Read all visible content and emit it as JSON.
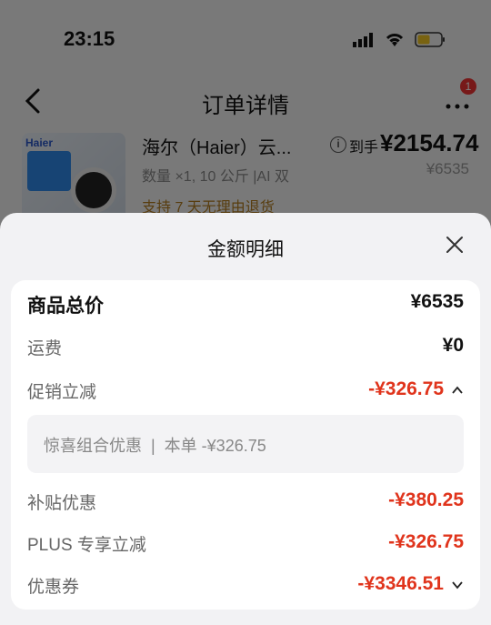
{
  "status_bar": {
    "time": "23:15"
  },
  "nav": {
    "title": "订单详情",
    "badge_count": "1"
  },
  "product": {
    "thumb_brand": "Haier",
    "name": "海尔（Haier）云...",
    "spec": "数量 ×1, 10 公斤 |AI 双",
    "return_policy": "支持 7 天无理由退货",
    "price_label": "到手",
    "price_main": "¥2154.74",
    "price_original": "¥6535"
  },
  "sheet": {
    "title": "金额明细",
    "rows": {
      "total": {
        "label": "商品总价",
        "value": "¥6535"
      },
      "shipping": {
        "label": "运费",
        "value": "¥0"
      },
      "promo": {
        "label": "促销立减",
        "value": "-¥326.75"
      },
      "promo_detail": "惊喜组合优惠  |  本单 -¥326.75",
      "subsidy": {
        "label": "补贴优惠",
        "value": "-¥380.25"
      },
      "plus": {
        "label": "PLUS 专享立减",
        "value": "-¥326.75"
      },
      "coupon": {
        "label": "优惠券",
        "value": "-¥3346.51"
      }
    }
  },
  "colors": {
    "discount_red": "#e0341c",
    "accent_gold": "#b07a1e"
  },
  "icons": [
    "signal-icon",
    "wifi-icon",
    "battery-icon",
    "back-icon",
    "more-icon",
    "info-icon",
    "close-icon",
    "chevron-up-icon",
    "chevron-down-icon"
  ]
}
